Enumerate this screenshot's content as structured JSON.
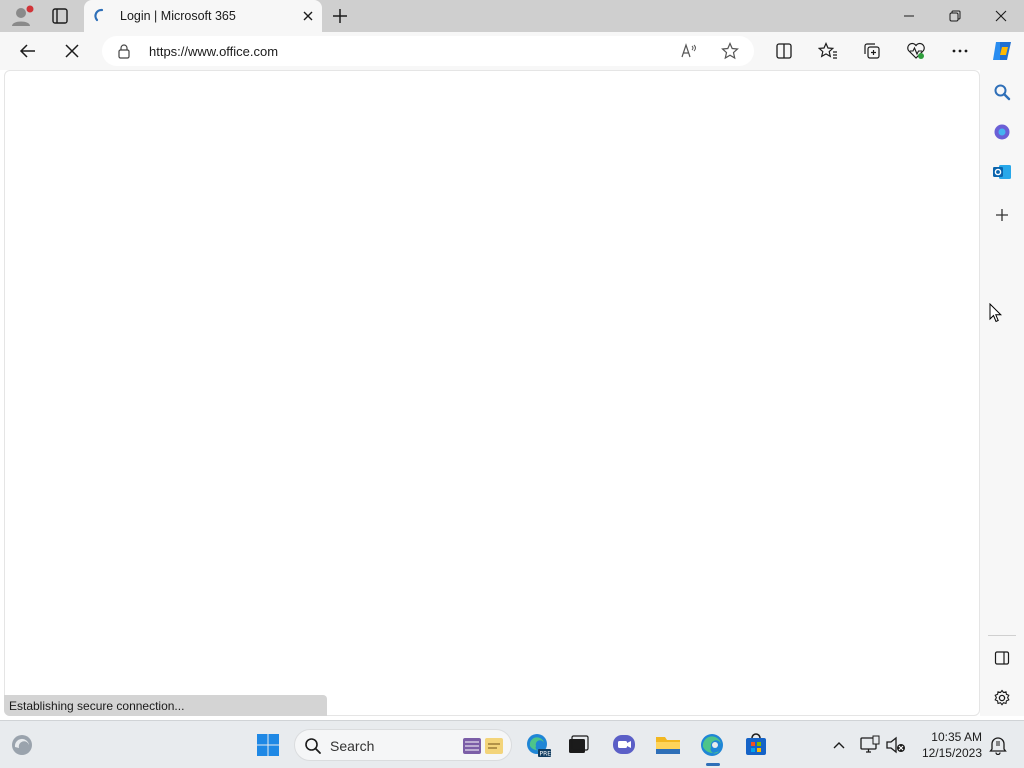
{
  "browser": {
    "tab": {
      "title": "Login | Microsoft 365",
      "loading": true
    },
    "address_bar": {
      "url": "https://www.office.com"
    },
    "status_text": "Establishing secure connection..."
  },
  "sidebar": {
    "icons": [
      "search-icon",
      "copilot-icon",
      "outlook-icon",
      "add-icon",
      "sidebar-panel-icon",
      "settings-icon"
    ]
  },
  "taskbar": {
    "search_placeholder": "Search",
    "time": "10:35 AM",
    "date": "12/15/2023",
    "pinned_apps": [
      "widgets",
      "start",
      "search",
      "edge-beta",
      "task-view",
      "teams",
      "file-explorer",
      "edge",
      "microsoft-store"
    ]
  },
  "colors": {
    "accent": "#2e6fb8",
    "tabstrip_bg": "#cfcfcf",
    "toolbar_bg": "#f7f7f7",
    "statusbar_bg": "#d4d4d4",
    "taskbar_bg": "#e8ebee"
  }
}
